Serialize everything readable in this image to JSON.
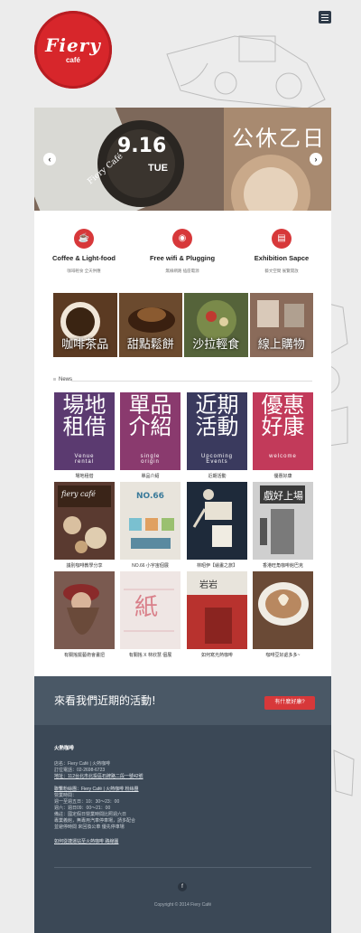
{
  "header": {
    "logo_text": "Fiery",
    "logo_sub": "café",
    "menu_icon": "hamburger-menu-icon"
  },
  "slider": {
    "date": "9.16",
    "day": "TUE",
    "title": "公休乙日",
    "prev_icon": "chevron-left-icon",
    "next_icon": "chevron-right-icon"
  },
  "features": [
    {
      "icon": "coffee-cup-icon",
      "title": "Coffee & Light-food",
      "sub": "咖啡輕食 全天供應"
    },
    {
      "icon": "wifi-rss-icon",
      "title": "Free wifi & Plugging",
      "sub": "無線網路 插座電源"
    },
    {
      "icon": "document-icon",
      "title": "Exhibition Sapce",
      "sub": "藝文空間 展覽開放"
    }
  ],
  "categories": [
    {
      "label": "咖啡茶品",
      "color": "#5b3a22"
    },
    {
      "label": "甜點鬆餅",
      "color": "#6b4a2e"
    },
    {
      "label": "沙拉輕食",
      "color": "#55633a"
    },
    {
      "label": "線上購物",
      "color": "#8a6b5a"
    }
  ],
  "news": {
    "heading": "News",
    "items": [
      {
        "title_line1": "場地",
        "title_line2": "租借",
        "sub1": "Venue",
        "sub2": "rental",
        "caption": "場地租借",
        "bg": "#5b3a70"
      },
      {
        "title_line1": "單品",
        "title_line2": "介紹",
        "sub1": "single",
        "sub2": "origin",
        "caption": "單品介紹",
        "bg": "#8a3a6e"
      },
      {
        "title_line1": "近期",
        "title_line2": "活動",
        "sub1": "Upcoming",
        "sub2": "Events",
        "caption": "近期活動",
        "bg": "#3a3a5e"
      },
      {
        "title_line1": "優惠",
        "title_line2": "好康",
        "sub1": "welcome",
        "sub2": "",
        "caption": "優惠好康",
        "bg": "#c23a5a"
      },
      {
        "caption": "議別咖啡教學分享",
        "bg": "#5a3a30",
        "overlay": "fiery café"
      },
      {
        "caption": "NO.66 小宇宙個展",
        "bg": "#e8e4dc",
        "overlay": "NO.66"
      },
      {
        "caption": "林昭伊【繪畫之旅】",
        "bg": "#1e2a3a",
        "overlay": ""
      },
      {
        "caption": "香港旺角咖啡館巴克",
        "bg": "#cfcfcf",
        "overlay": "戲好上場"
      },
      {
        "caption": "有關搖擺藝術會畫扭",
        "bg": "#7a5a50",
        "overlay": ""
      },
      {
        "caption": "有關搖 X 林欣慧 個展",
        "bg": "#efe6e4",
        "overlay": "紙"
      },
      {
        "caption": "如何寫光熱咖啡",
        "bg": "#b8322e",
        "overlay": "岩岩"
      },
      {
        "caption": "咖啡豆好處多多~",
        "bg": "#6a4a36",
        "overlay": ""
      }
    ]
  },
  "cta": {
    "text": "來看我們近期的活動!",
    "button": "有什麼好康?"
  },
  "footer": {
    "heading": "火熱咖啡",
    "lines": [
      "店名：Fiery Café | 火熱咖啡",
      "訂位電話：02-2698-6723",
      "地址：112台北市北投區石牌路二段一號42號",
      "聯繫粉絲團：Fiery Café | 火熱咖啡 粉絲團",
      "營業時間：",
      "週一至週五日：10：30～23：00",
      "週六：週日09：00～21：00",
      "備註：國定假日營業時間比照週六日",
      "專業義館，無專用汽車停車場，請多配合",
      "並避停時間 來回換公車 優先停車場"
    ],
    "link": "如何從捷運站至火熱咖啡 路線圖",
    "fb_icon": "facebook-icon",
    "copyright": "Copyright © 2014 Fiery Café"
  }
}
